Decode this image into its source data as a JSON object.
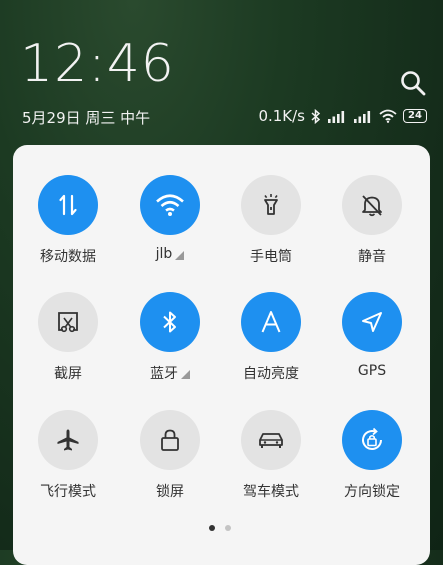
{
  "header": {
    "time": "12:46",
    "date": "5月29日 周三 中午",
    "net_speed": "0.1K/s",
    "battery": "24"
  },
  "colors": {
    "active": "#1e90f0",
    "inactive": "#e3e3e3",
    "icon_active": "#ffffff",
    "icon_inactive": "#333333"
  },
  "tiles": [
    {
      "label": "移动数据",
      "icon": "mobile-data-icon",
      "active": true
    },
    {
      "label": "jlb",
      "icon": "wifi-icon",
      "active": true,
      "expand": true
    },
    {
      "label": "手电筒",
      "icon": "flashlight-icon",
      "active": false
    },
    {
      "label": "静音",
      "icon": "mute-icon",
      "active": false
    },
    {
      "label": "截屏",
      "icon": "screenshot-icon",
      "active": false
    },
    {
      "label": "蓝牙",
      "icon": "bluetooth-icon",
      "active": true,
      "expand": true
    },
    {
      "label": "自动亮度",
      "icon": "auto-brightness-icon",
      "active": true
    },
    {
      "label": "GPS",
      "icon": "gps-icon",
      "active": true
    },
    {
      "label": "飞行模式",
      "icon": "airplane-icon",
      "active": false
    },
    {
      "label": "锁屏",
      "icon": "lock-icon",
      "active": false
    },
    {
      "label": "驾车模式",
      "icon": "car-icon",
      "active": false
    },
    {
      "label": "方向锁定",
      "icon": "rotation-lock-icon",
      "active": true
    }
  ],
  "pager": {
    "current": 1,
    "total": 2
  }
}
